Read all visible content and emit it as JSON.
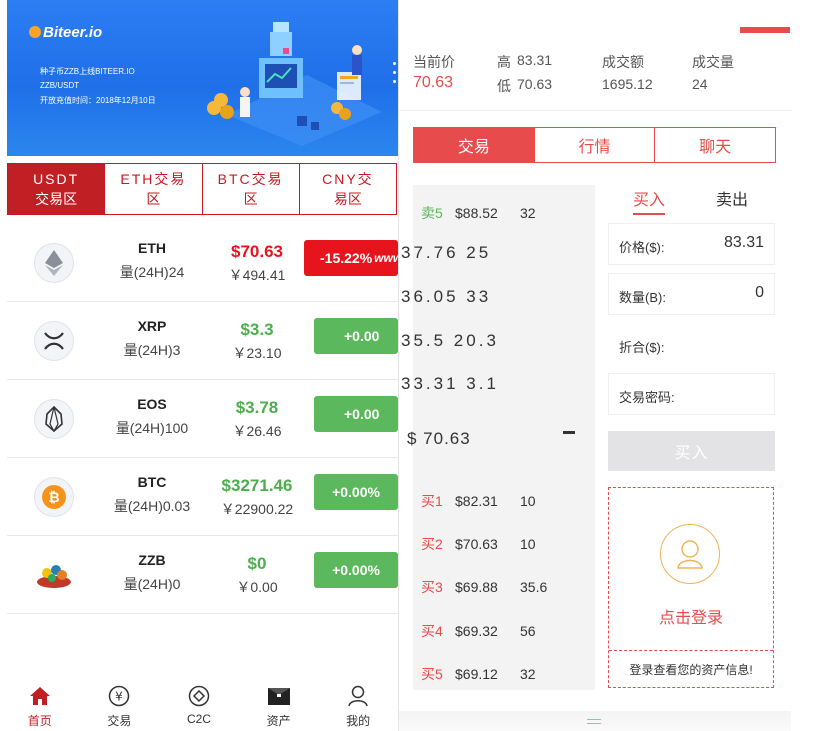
{
  "banner": {
    "logo": "Biteer.io",
    "line1": "种子币ZZB上线BITEER.IO",
    "line2": "ZZB/USDT",
    "line3": "开放充值时间：2018年12月10日"
  },
  "market_tabs": [
    {
      "top": "USDT",
      "bottom": "交易区",
      "active": true
    },
    {
      "top": "ETH交易",
      "bottom": "区",
      "active": false
    },
    {
      "top": "BTC交易",
      "bottom": "区",
      "active": false
    },
    {
      "top": "CNY交",
      "bottom": "易区",
      "active": false
    }
  ],
  "coins": [
    {
      "name": "ETH",
      "volume": "量(24H)24",
      "price": "$70.63",
      "cny": "￥494.41",
      "change": "-15.22%",
      "change_suffix": "www.",
      "trend": "down",
      "icon": "eth-icon"
    },
    {
      "name": "XRP",
      "volume": "量(24H)3",
      "price": "$3.3",
      "cny": "￥23.10",
      "change": "+0.00",
      "trend": "up",
      "icon": "xrp-icon"
    },
    {
      "name": "EOS",
      "volume": "量(24H)100",
      "price": "$3.78",
      "cny": "￥26.46",
      "change": "+0.00",
      "trend": "up",
      "icon": "eos-icon"
    },
    {
      "name": "BTC",
      "volume": "量(24H)0.03",
      "price": "$3271.46",
      "cny": "￥22900.22",
      "change": "+0.00%",
      "trend": "up",
      "icon": "btc-icon"
    },
    {
      "name": "ZZB",
      "volume": "量(24H)0",
      "price": "$0",
      "cny": "￥0.00",
      "change": "+0.00%",
      "trend": "up",
      "icon": "zzb-icon"
    }
  ],
  "bottom_nav": [
    {
      "label": "首页",
      "icon": "home-icon",
      "active": true
    },
    {
      "label": "交易",
      "icon": "yen-coin-icon",
      "active": false
    },
    {
      "label": "C2C",
      "icon": "c2c-icon",
      "active": false
    },
    {
      "label": "资产",
      "icon": "wallet-icon",
      "active": false
    },
    {
      "label": "我的",
      "icon": "user-icon",
      "active": false
    }
  ],
  "stats": {
    "current_label": "当前价",
    "current_value": "70.63",
    "high_label": "高",
    "high_value": "83.31",
    "low_label": "低",
    "low_value": "70.63",
    "amount_label": "成交额",
    "amount_value": "1695.12",
    "volume_label": "成交量",
    "volume_value": "24"
  },
  "trade_tabs": [
    {
      "label": "交易",
      "active": true
    },
    {
      "label": "行情",
      "active": false
    },
    {
      "label": "聊天",
      "active": false
    }
  ],
  "orderbook": {
    "sell5": {
      "label": "卖5",
      "price": "$88.52",
      "qty": "32"
    },
    "big_rows": [
      "37.76  25",
      "36.05  33",
      "35.5  20.3",
      "33.31  3.1"
    ],
    "last_price": "$ 70.63",
    "buys": [
      {
        "label": "买1",
        "price": "$82.31",
        "qty": "10"
      },
      {
        "label": "买2",
        "price": "$70.63",
        "qty": "10"
      },
      {
        "label": "买3",
        "price": "$69.88",
        "qty": "35.6"
      },
      {
        "label": "买4",
        "price": "$69.32",
        "qty": "56"
      },
      {
        "label": "买5",
        "price": "$69.12",
        "qty": "32"
      }
    ]
  },
  "form": {
    "buy_tab": "买入",
    "sell_tab": "卖出",
    "price_label": "价格($):",
    "price_value": "83.31",
    "qty_label": "数量(B):",
    "qty_value": "0",
    "total_label": "折合($):",
    "password_label": "交易密码:",
    "submit_label": "买入"
  },
  "login": {
    "action": "点击登录",
    "note": "登录查看您的资产信息!"
  },
  "colors": {
    "brand_red": "#c01f24",
    "accent_red": "#e84b4b",
    "up_green": "#5cb85c",
    "down_red": "#e8141d",
    "banner_blue": "#2d7df3"
  }
}
